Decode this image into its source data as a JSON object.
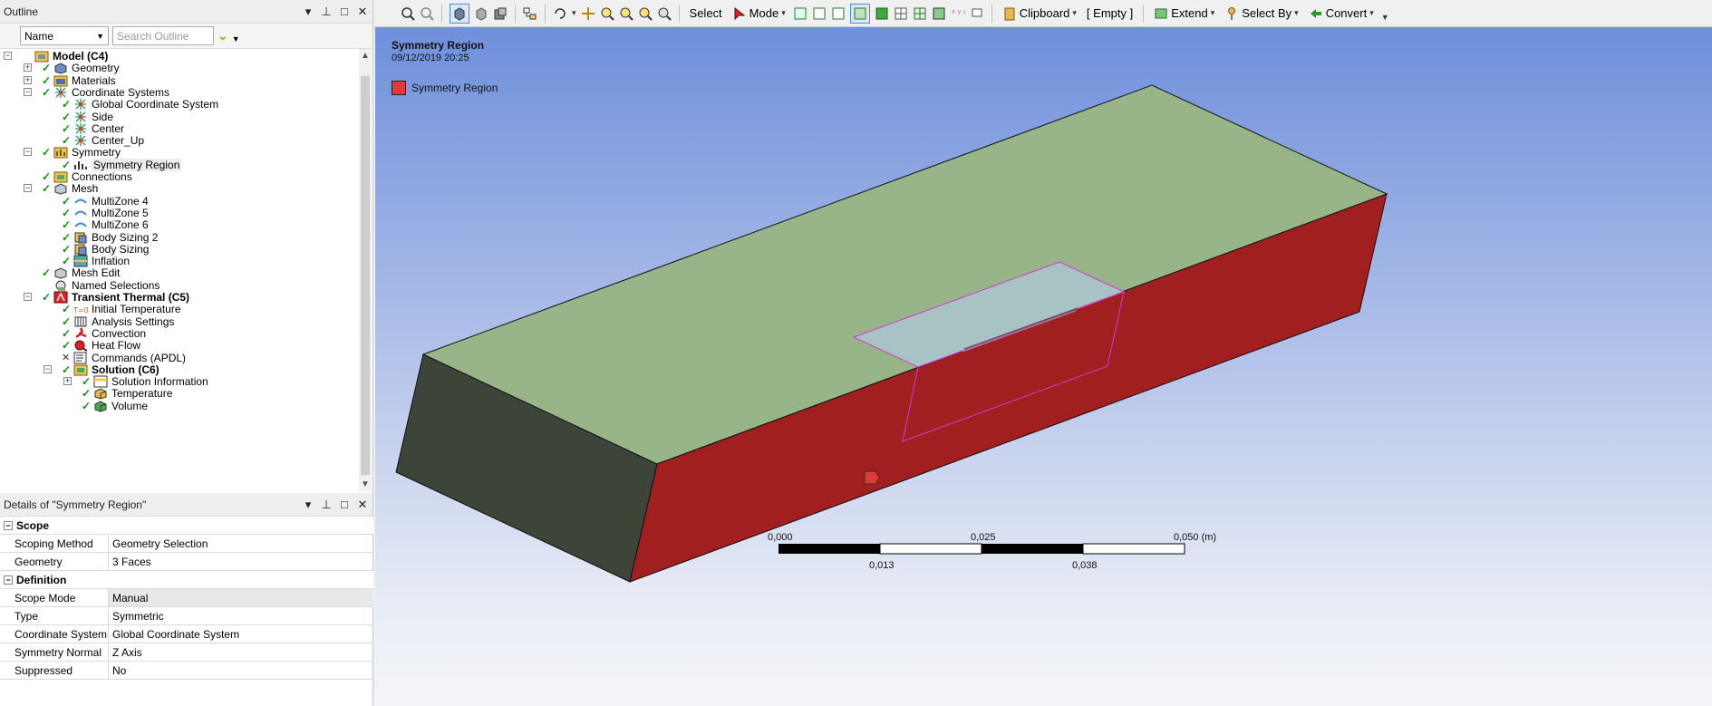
{
  "outline": {
    "title": "Outline",
    "filter_select": "Name",
    "search_placeholder": "Search Outline",
    "tree": [
      {
        "label": "Model (C4)",
        "bold": true
      },
      {
        "label": "Geometry"
      },
      {
        "label": "Materials"
      },
      {
        "label": "Coordinate Systems"
      },
      {
        "label": "Global Coordinate System"
      },
      {
        "label": "Side"
      },
      {
        "label": "Center"
      },
      {
        "label": "Center_Up"
      },
      {
        "label": "Symmetry"
      },
      {
        "label": "Symmetry Region",
        "selected": true
      },
      {
        "label": "Connections"
      },
      {
        "label": "Mesh"
      },
      {
        "label": "MultiZone 4"
      },
      {
        "label": "MultiZone 5"
      },
      {
        "label": "MultiZone 6"
      },
      {
        "label": "Body Sizing 2"
      },
      {
        "label": "Body Sizing"
      },
      {
        "label": "Inflation"
      },
      {
        "label": "Mesh Edit"
      },
      {
        "label": "Named Selections"
      },
      {
        "label": "Transient Thermal (C5)",
        "bold": true
      },
      {
        "label": "Initial Temperature"
      },
      {
        "label": "Analysis Settings"
      },
      {
        "label": "Convection"
      },
      {
        "label": "Heat Flow"
      },
      {
        "label": "Commands (APDL)"
      },
      {
        "label": "Solution (C6)",
        "bold": true
      },
      {
        "label": "Solution Information"
      },
      {
        "label": "Temperature"
      },
      {
        "label": "Volume"
      }
    ]
  },
  "details": {
    "title": "Details of \"Symmetry Region\"",
    "groups": [
      {
        "name": "Scope",
        "rows": [
          {
            "key": "Scoping Method",
            "value": "Geometry Selection"
          },
          {
            "key": "Geometry",
            "value": "3 Faces"
          }
        ]
      },
      {
        "name": "Definition",
        "rows": [
          {
            "key": "Scope Mode",
            "value": "Manual"
          },
          {
            "key": "Type",
            "value": "Symmetric"
          },
          {
            "key": "Coordinate System",
            "value": "Global Coordinate System"
          },
          {
            "key": "Symmetry Normal",
            "value": "Z Axis"
          },
          {
            "key": "Suppressed",
            "value": "No"
          }
        ]
      }
    ]
  },
  "toolbar": {
    "select_label": "Select",
    "mode_label": "Mode",
    "clipboard_label": "Clipboard",
    "empty_label": "[ Empty ]",
    "extend_label": "Extend",
    "select_by_label": "Select By",
    "convert_label": "Convert"
  },
  "viewport": {
    "title": "Symmetry Region",
    "date": "09/12/2019 20:25",
    "legend_label": "Symmetry Region",
    "legend_color": "#e23838",
    "scale_top": [
      "0,000",
      "0,025",
      "0,050 (m)"
    ],
    "scale_bottom": [
      "0,013",
      "0,038"
    ]
  },
  "colors": {
    "top_face": "#98b589",
    "front_face": "#a11f1f",
    "side_face": "#3d4538",
    "selection_outline": "#d23ad2"
  }
}
